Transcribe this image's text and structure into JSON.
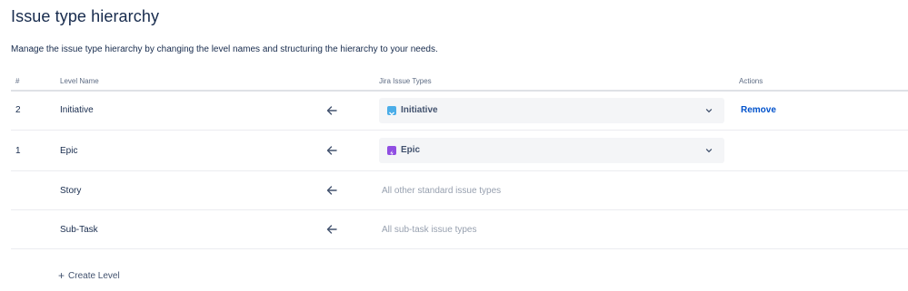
{
  "page": {
    "title": "Issue type hierarchy",
    "description": "Manage the issue type hierarchy by changing the level names and structuring the hierarchy to your needs."
  },
  "table": {
    "headers": {
      "number": "#",
      "level_name": "Level Name",
      "issue_types": "Jira Issue Types",
      "actions": "Actions"
    },
    "rows": [
      {
        "number": "2",
        "level_name": "Initiative",
        "issue_type": "Initiative",
        "icon": "initiative-icon",
        "icon_color": "#4bade8",
        "action": "Remove"
      },
      {
        "number": "1",
        "level_name": "Epic",
        "issue_type": "Epic",
        "icon": "epic-icon",
        "icon_color": "#904ee2"
      },
      {
        "number": "",
        "level_name": "Story",
        "issue_type_text": "All other standard issue types"
      },
      {
        "number": "",
        "level_name": "Sub-Task",
        "issue_type_text": "All sub-task issue types"
      }
    ]
  },
  "footer": {
    "create_label": "Create Level",
    "create_icon": "plus-icon"
  },
  "colors": {
    "link": "#0052cc",
    "text": "#172b4d",
    "muted": "#97a0af",
    "select_bg": "#f4f5f7"
  }
}
